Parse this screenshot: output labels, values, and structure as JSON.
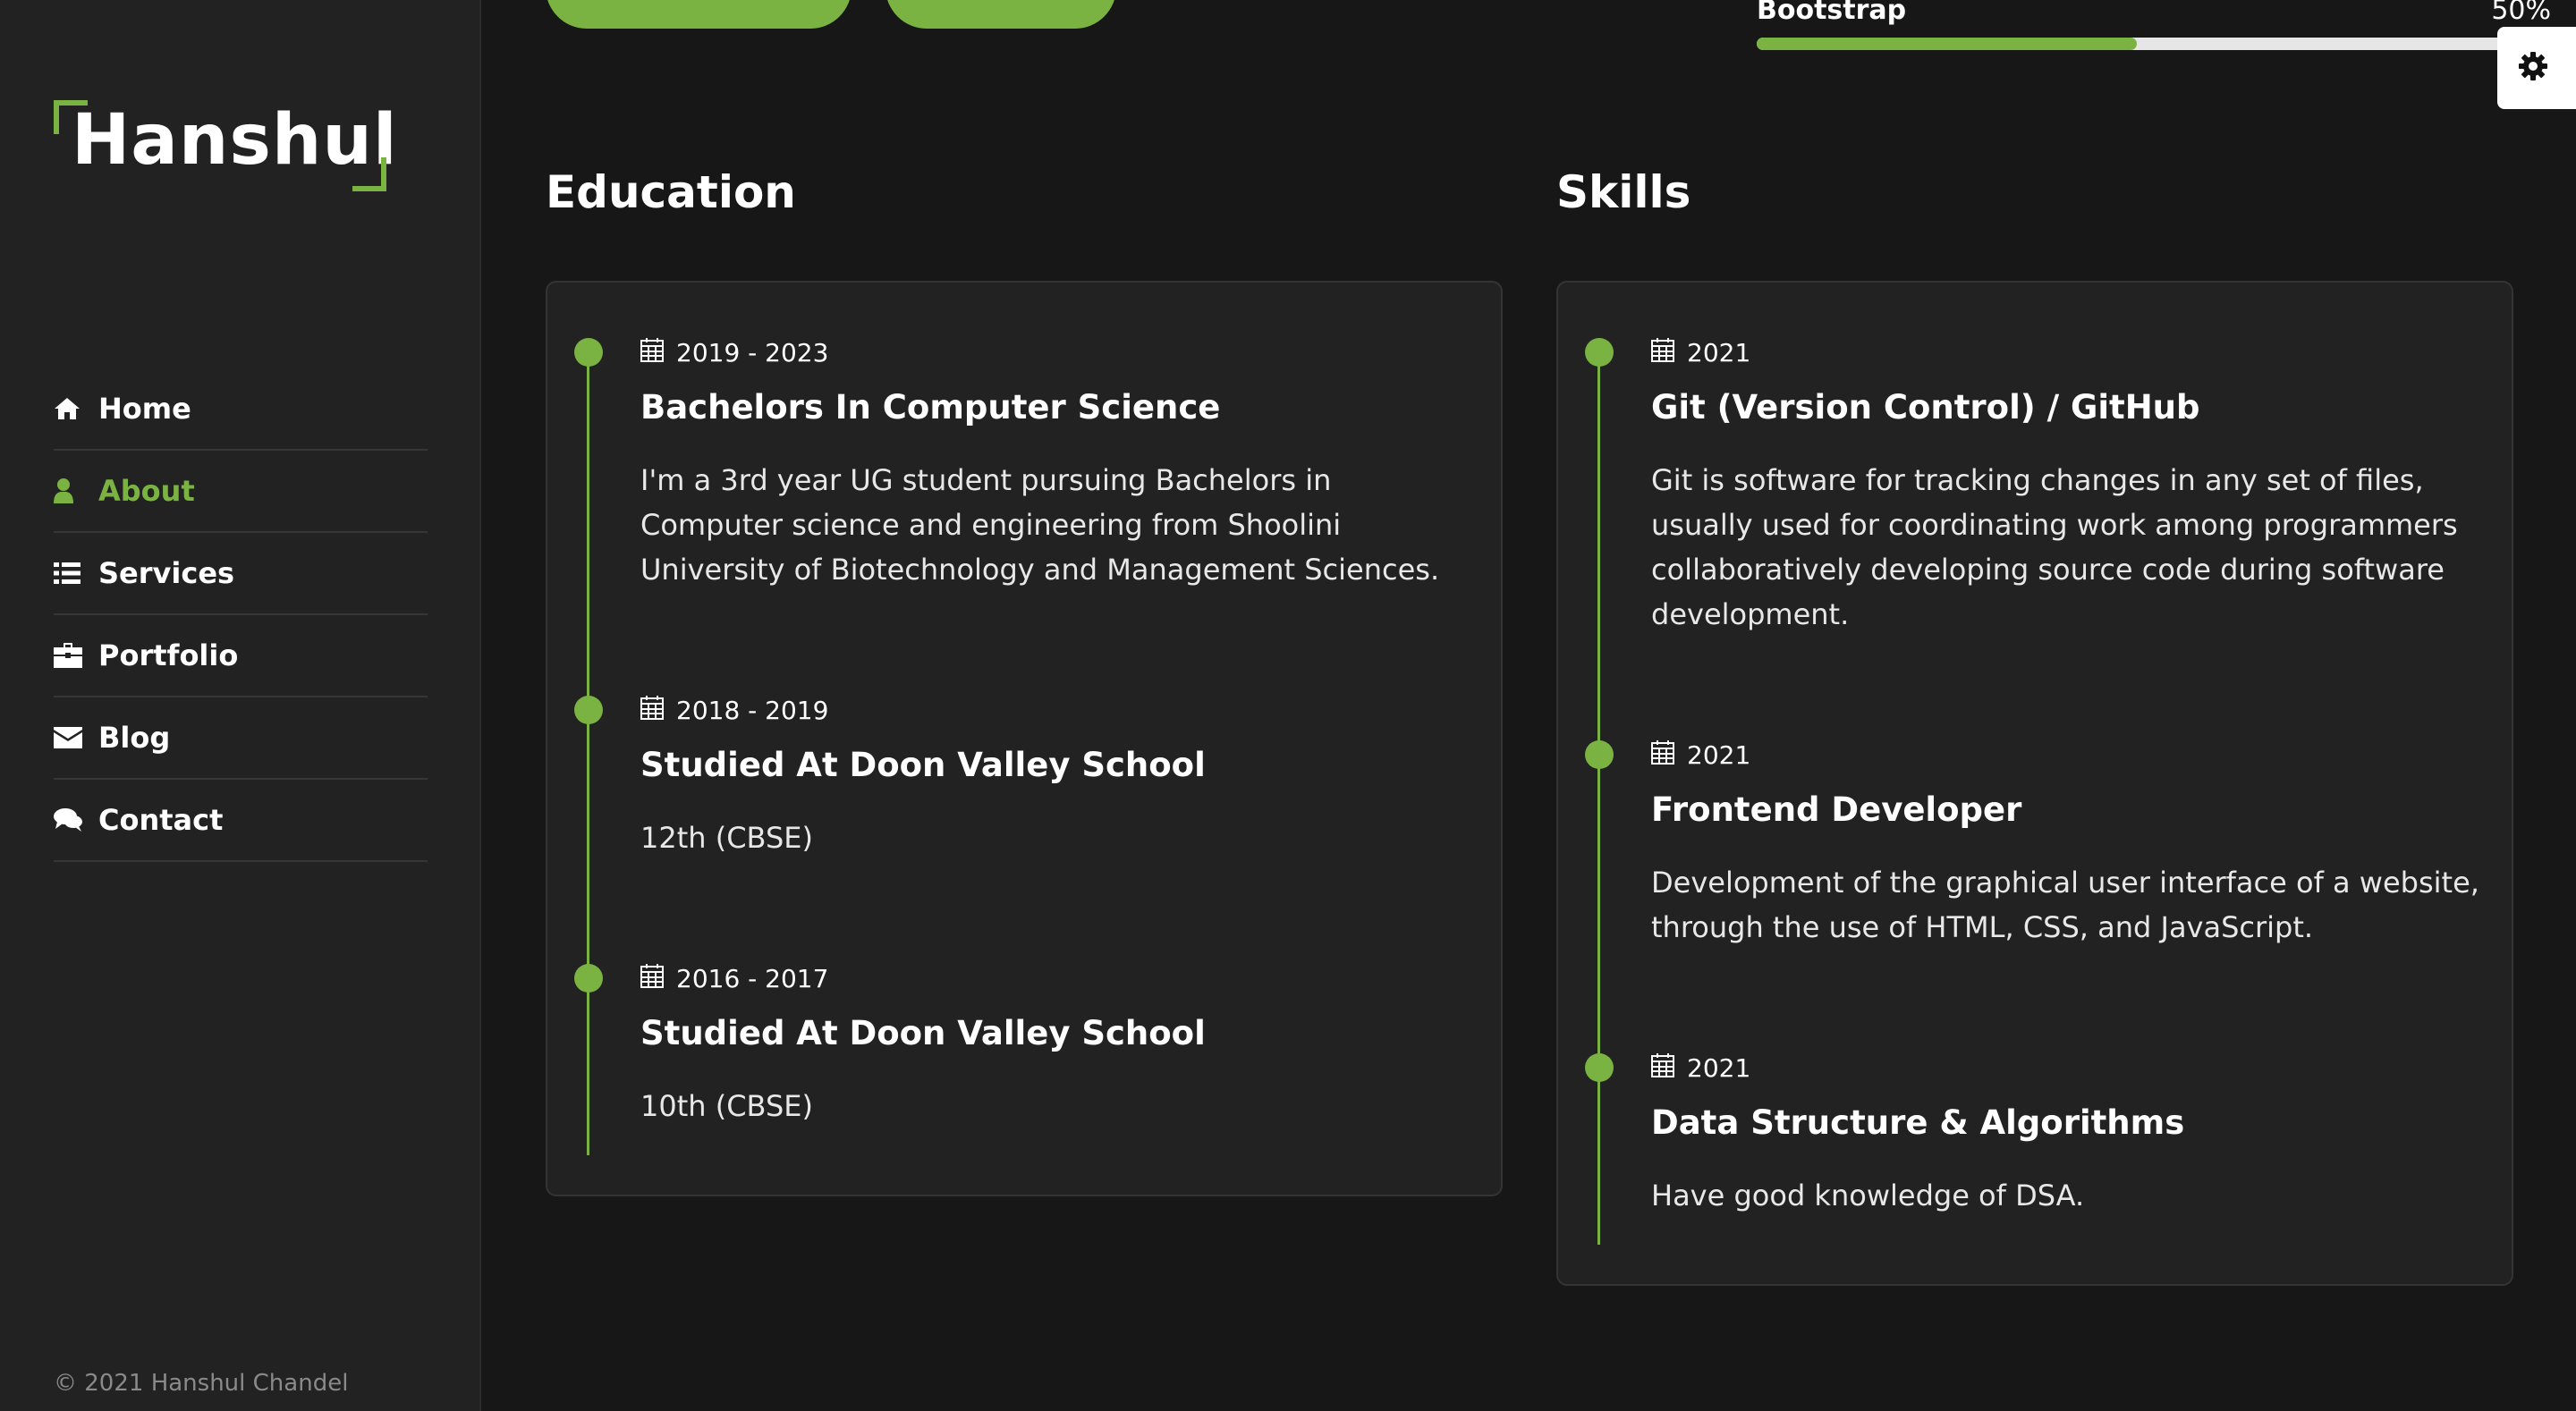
{
  "brand": {
    "name": "Hanshul",
    "accent_color": "#7ab342"
  },
  "nav": {
    "items": [
      {
        "label": "Home",
        "icon": "home-icon",
        "active": false
      },
      {
        "label": "About",
        "icon": "user-icon",
        "active": true
      },
      {
        "label": "Services",
        "icon": "list-icon",
        "active": false
      },
      {
        "label": "Portfolio",
        "icon": "briefcase-icon",
        "active": false
      },
      {
        "label": "Blog",
        "icon": "envelope-icon",
        "active": false
      },
      {
        "label": "Contact",
        "icon": "comments-icon",
        "active": false
      }
    ]
  },
  "footer": {
    "copyright": "© 2021 Hanshul Chandel"
  },
  "skill_bar": {
    "label": "Bootstrap",
    "percent_text": "50%",
    "percent": 50
  },
  "education": {
    "title": "Education",
    "items": [
      {
        "date": "2019 - 2023",
        "title": "Bachelors In Computer Science",
        "description": "I'm a 3rd year UG student pursuing Bachelors in Computer science and engineering from Shoolini University of Biotechnology and Management Sciences."
      },
      {
        "date": "2018 - 2019",
        "title": "Studied At Doon Valley School",
        "description": "12th (CBSE)"
      },
      {
        "date": "2016 - 2017",
        "title": "Studied At Doon Valley School",
        "description": "10th (CBSE)"
      }
    ]
  },
  "skills": {
    "title": "Skills",
    "items": [
      {
        "date": "2021",
        "title": "Git (Version Control) / GitHub",
        "description": "Git is software for tracking changes in any set of files, usually used for coordinating work among programmers collaboratively developing source code during software development."
      },
      {
        "date": "2021",
        "title": "Frontend Developer",
        "description": "Development of the graphical user interface of a website, through the use of HTML, CSS, and JavaScript."
      },
      {
        "date": "2021",
        "title": "Data Structure & Algorithms",
        "description": "Have good knowledge of DSA."
      }
    ]
  }
}
